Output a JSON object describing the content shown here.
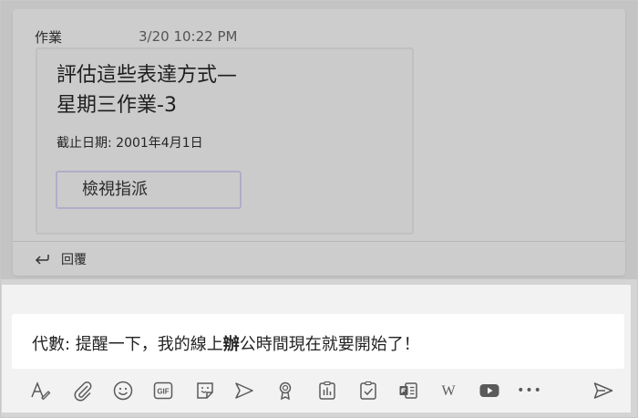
{
  "post": {
    "author": "作業",
    "timestamp": "3/20 10:22 PM",
    "card": {
      "title_line1": "評估這些表達方式—",
      "title_line2": "星期三作業-3",
      "due": "截止日期: 2001年4月1日",
      "view_button": "檢視指派"
    },
    "reply_label": "回覆"
  },
  "compose": {
    "prefix": "代數: 提醒一下，我的線上",
    "bold_char": "辦",
    "suffix": "公時間現在就要開始了！"
  },
  "toolbar": {
    "icons": [
      "format-icon",
      "attach-icon",
      "emoji-icon",
      "gif-icon",
      "sticker-icon",
      "stream-icon",
      "praise-icon",
      "polls-icon",
      "assignments-icon",
      "forms-icon",
      "wikipedia-icon",
      "youtube-icon",
      "more-options-icon",
      "send-icon"
    ],
    "gif_label": "GIF",
    "wiki_label": "W",
    "more_label": "•••"
  },
  "colors": {
    "dim_overlay": "#c4c4c4",
    "compose_bg": "#f2f2f2",
    "icon": "#5a5a5a",
    "button_border": "#b0aec8"
  }
}
